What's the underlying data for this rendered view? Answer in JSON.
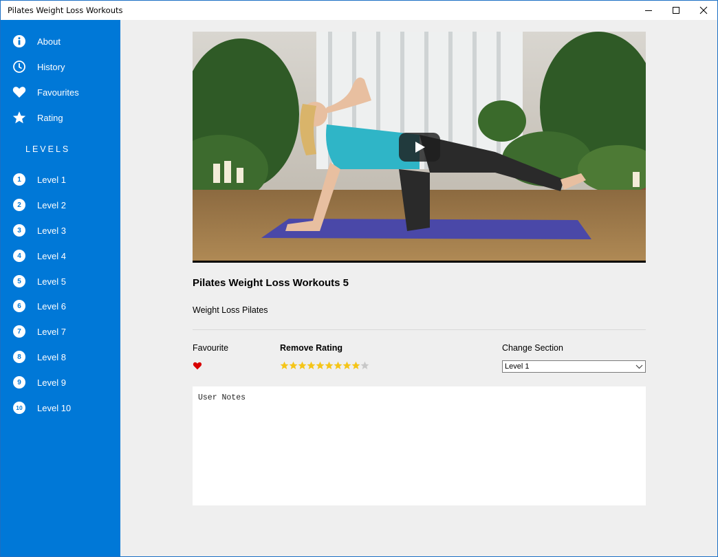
{
  "window": {
    "title": "Pilates Weight Loss Workouts"
  },
  "sidebar": {
    "items": [
      {
        "label": "About",
        "icon": "info-icon"
      },
      {
        "label": "History",
        "icon": "clock-icon"
      },
      {
        "label": "Favourites",
        "icon": "heart-icon"
      },
      {
        "label": "Rating",
        "icon": "star-icon"
      }
    ],
    "levels_heading": "LEVELS",
    "levels": [
      {
        "num": "1",
        "label": "Level 1"
      },
      {
        "num": "2",
        "label": "Level 2"
      },
      {
        "num": "3",
        "label": "Level 3"
      },
      {
        "num": "4",
        "label": "Level 4"
      },
      {
        "num": "5",
        "label": "Level 5"
      },
      {
        "num": "6",
        "label": "Level 6"
      },
      {
        "num": "7",
        "label": "Level 7"
      },
      {
        "num": "8",
        "label": "Level 8"
      },
      {
        "num": "9",
        "label": "Level 9"
      },
      {
        "num": "10",
        "label": "Level 10"
      }
    ]
  },
  "main": {
    "video_title": "Pilates Weight Loss Workouts 5",
    "video_subtitle": "Weight Loss Pilates",
    "favourite_label": "Favourite",
    "rating_label": "Remove Rating",
    "rating_value": 9,
    "rating_max": 10,
    "section_label": "Change Section",
    "section_selected": "Level 1",
    "notes_placeholder": "User Notes"
  },
  "colors": {
    "sidebar": "#0078d7",
    "star_filled": "#f5c518",
    "star_empty": "#c8c8c8",
    "heart": "#d80000"
  }
}
